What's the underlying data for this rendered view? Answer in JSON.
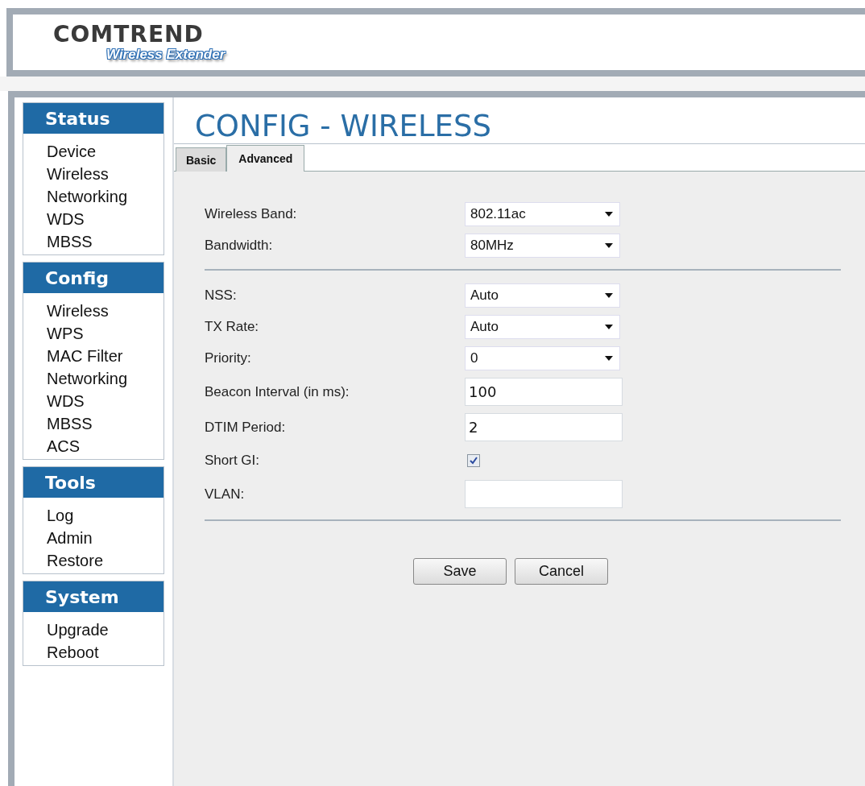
{
  "header": {
    "brand": "COMTREND",
    "product": "Wireless Extender"
  },
  "sidebar": [
    {
      "title": "Status",
      "items": [
        "Device",
        "Wireless",
        "Networking",
        "WDS",
        "MBSS"
      ]
    },
    {
      "title": "Config",
      "items": [
        "Wireless",
        "WPS",
        "MAC Filter",
        "Networking",
        "WDS",
        "MBSS",
        "ACS"
      ]
    },
    {
      "title": "Tools",
      "items": [
        "Log",
        "Admin",
        "Restore"
      ]
    },
    {
      "title": "System",
      "items": [
        "Upgrade",
        "Reboot"
      ]
    }
  ],
  "page_title": "CONFIG - WIRELESS",
  "tabs": [
    {
      "label": "Basic",
      "selected": false
    },
    {
      "label": "Advanced",
      "selected": true
    }
  ],
  "sections": [
    [
      {
        "kind": "select",
        "label": "Wireless Band:",
        "value": "802.11ac"
      },
      {
        "kind": "select",
        "label": "Bandwidth:",
        "value": "80MHz"
      }
    ],
    [
      {
        "kind": "select",
        "label": "NSS:",
        "value": "Auto"
      },
      {
        "kind": "select",
        "label": "TX Rate:",
        "value": "Auto"
      },
      {
        "kind": "select",
        "label": "Priority:",
        "value": "0"
      },
      {
        "kind": "text",
        "label": "Beacon Interval (in ms):",
        "value": "100"
      },
      {
        "kind": "text",
        "label": "DTIM Period:",
        "value": "2"
      },
      {
        "kind": "checkbox",
        "label": "Short GI:",
        "checked": true
      },
      {
        "kind": "text",
        "label": "VLAN:"
      }
    ]
  ],
  "buttons": [
    "Save",
    "Cancel"
  ]
}
